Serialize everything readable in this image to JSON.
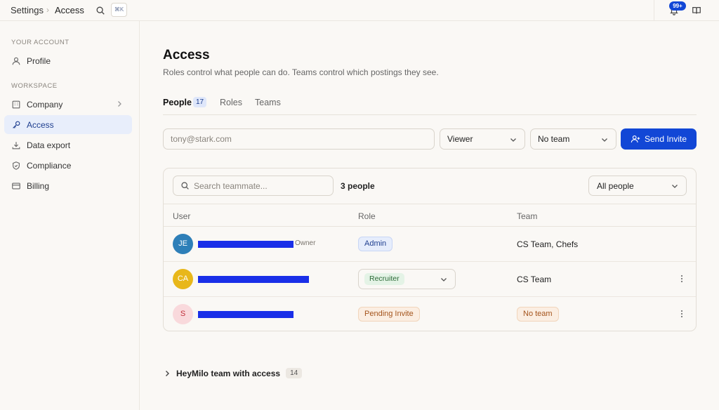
{
  "topbar": {
    "breadcrumb_parent": "Settings",
    "breadcrumb_sep": "›",
    "breadcrumb_current": "Access",
    "shortcut": "⌘K",
    "notifications_badge": "99+"
  },
  "sidebar": {
    "section_account": "YOUR ACCOUNT",
    "section_workspace": "WORKSPACE",
    "items": [
      {
        "label": "Profile",
        "icon": "user-icon"
      },
      {
        "label": "Company",
        "icon": "building-icon"
      },
      {
        "label": "Access",
        "icon": "key-icon"
      },
      {
        "label": "Data export",
        "icon": "download-icon"
      },
      {
        "label": "Compliance",
        "icon": "shield-icon"
      },
      {
        "label": "Billing",
        "icon": "credit-card-icon"
      }
    ]
  },
  "main": {
    "title": "Access",
    "subtitle": "Roles control what people can do. Teams control which postings they see.",
    "tabs": [
      {
        "label": "People",
        "count": "17"
      },
      {
        "label": "Roles"
      },
      {
        "label": "Teams"
      }
    ],
    "invite": {
      "email_placeholder": "tony@stark.com",
      "role_value": "Viewer",
      "team_value": "No team",
      "send_label": "Send Invite"
    },
    "table": {
      "search_placeholder": "Search teammate...",
      "people_count": "3 people",
      "filter_value": "All people",
      "headers": [
        "User",
        "Role",
        "Team"
      ],
      "rows": [
        {
          "initials": "JE",
          "owner_tag": "Owner",
          "role": "Admin",
          "team": "CS Team, Chefs"
        },
        {
          "initials": "CA",
          "role": "Recruiter",
          "team": "CS Team"
        },
        {
          "initials": "S",
          "role": "Pending Invite",
          "team": "No team"
        }
      ]
    },
    "accordion": {
      "label": "HeyMilo team with access",
      "count": "14"
    }
  },
  "colors": {
    "accent": "#1247d6",
    "redaction": "#1a2fe8",
    "avatar_je": "#2e7fb8",
    "avatar_ca": "#e8b71a",
    "avatar_s": "#f9d9dc"
  }
}
